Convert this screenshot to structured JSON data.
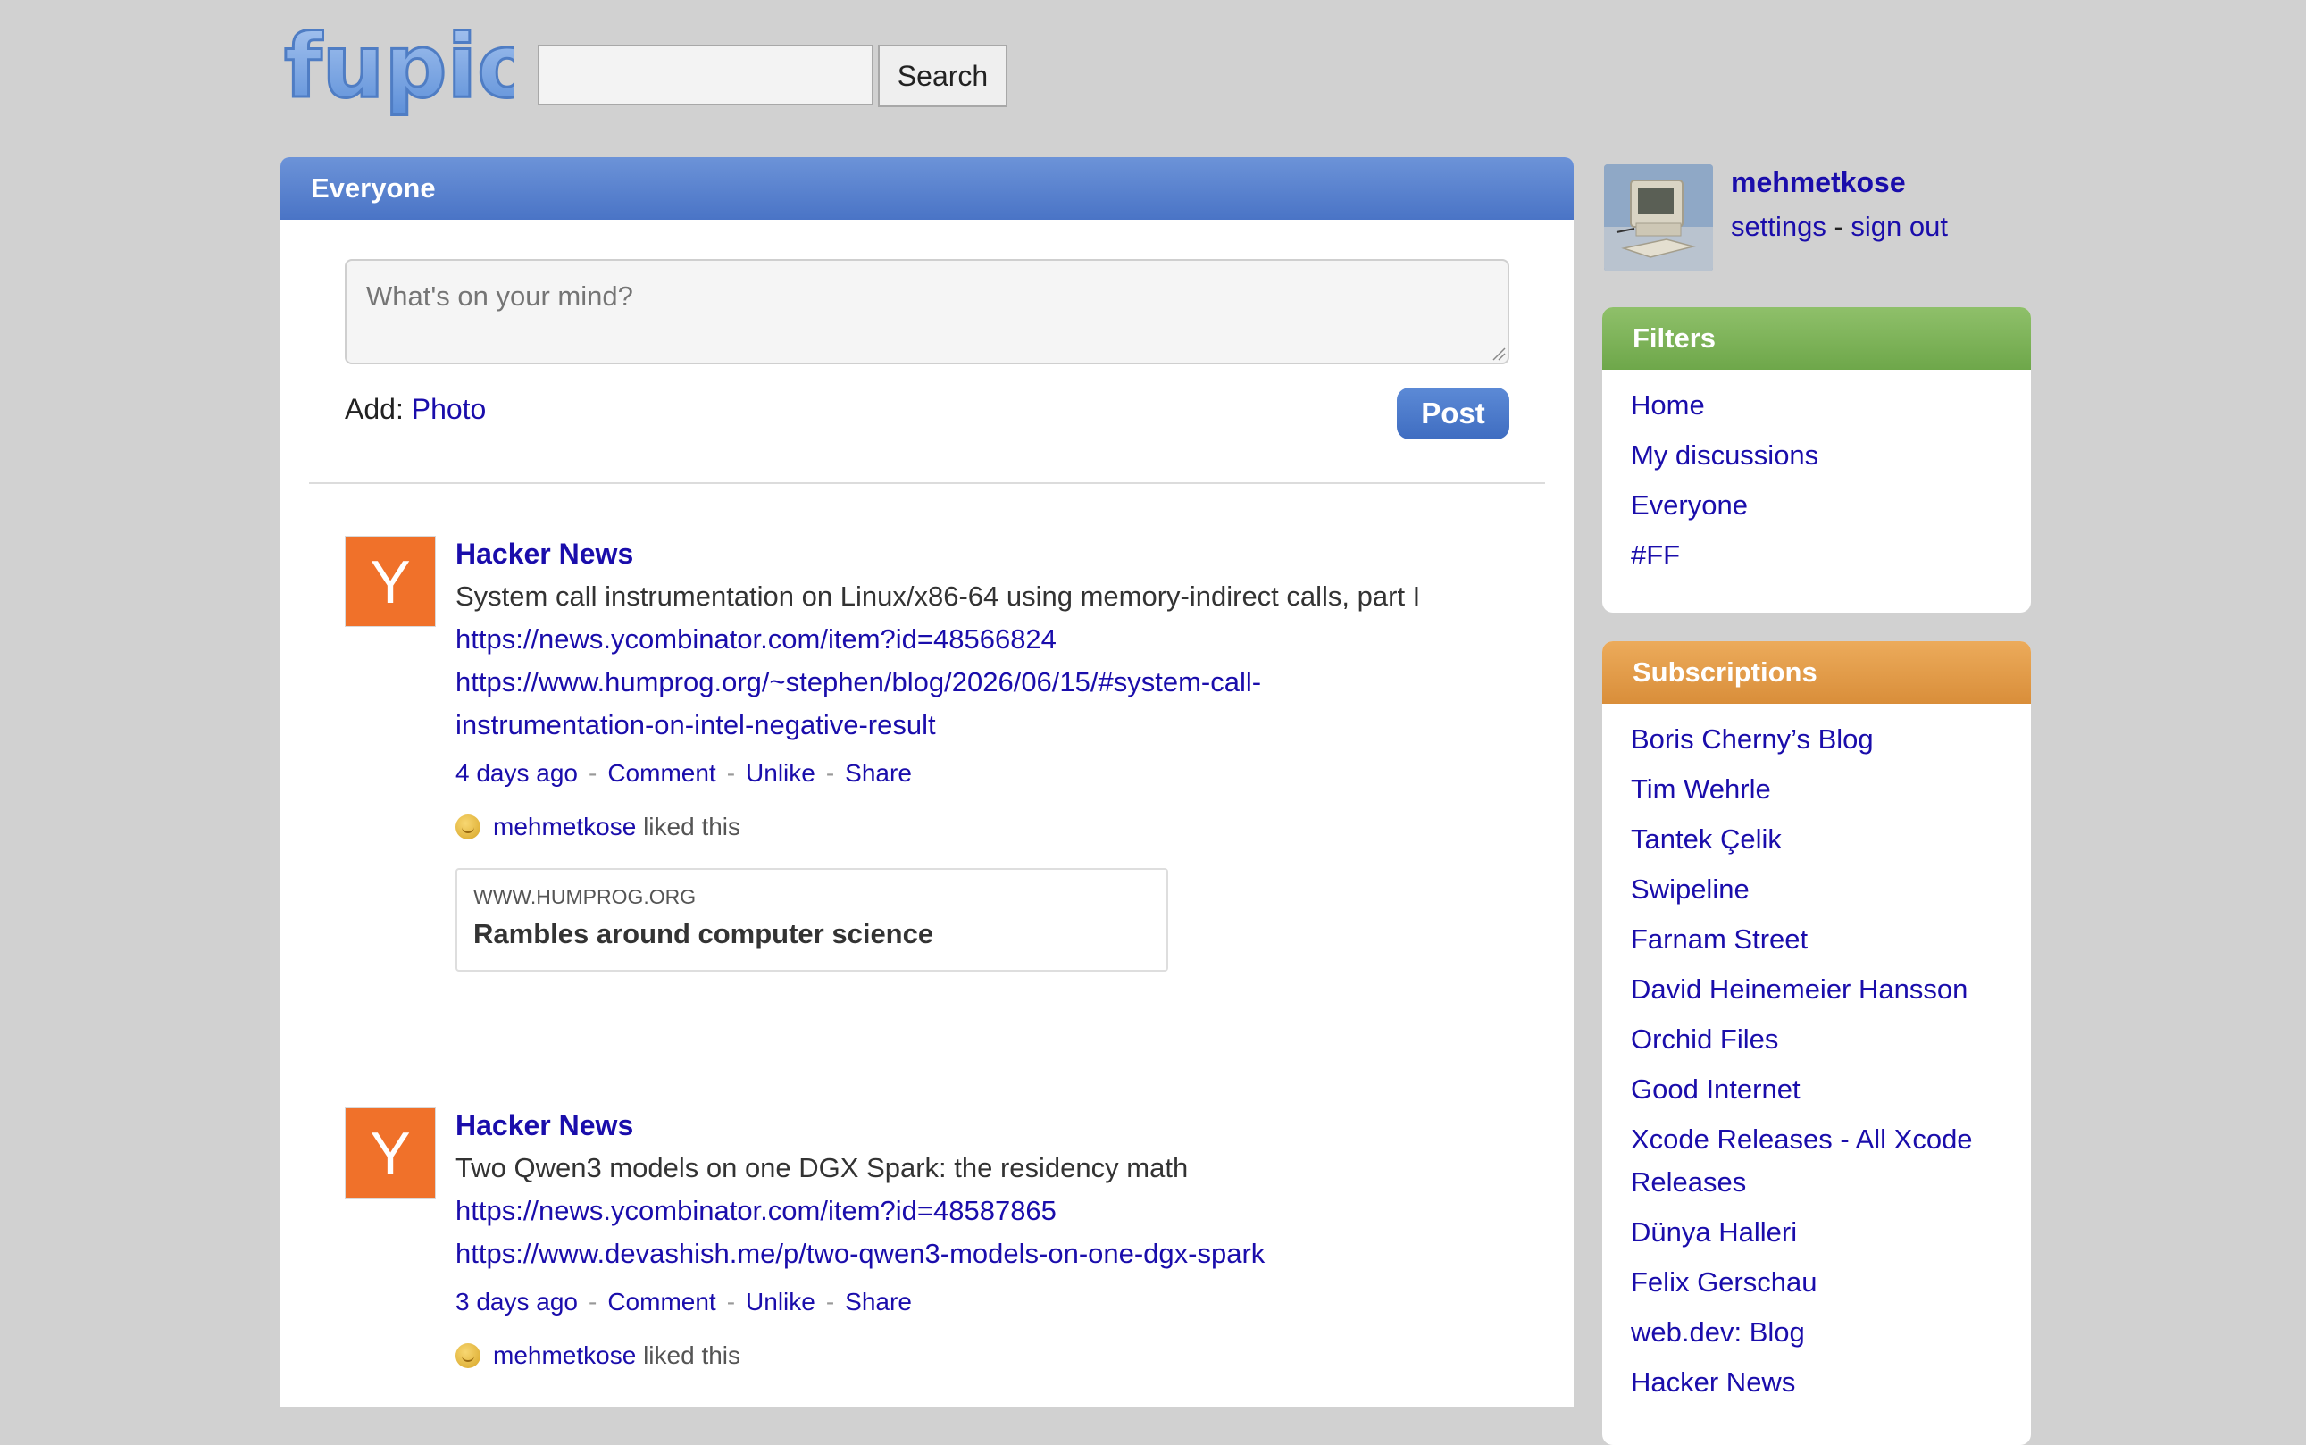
{
  "header": {
    "logo_text": "fupio",
    "search": {
      "value": "",
      "placeholder": ""
    },
    "search_button_label": "Search"
  },
  "feed": {
    "title": "Everyone",
    "composer": {
      "placeholder": "What's on your mind?",
      "value": ""
    },
    "add_label": "Add:",
    "add_photo_label": "Photo",
    "post_button_label": "Post",
    "posts": [
      {
        "avatar_letter": "Y",
        "source": "Hacker News",
        "text": "System call instrumentation on Linux/x86-64 using memory-indirect calls, part I",
        "links": [
          "https://news.ycombinator.com/item?id=48566824",
          "https://www.humprog.org/~stephen/blog/2026/06/15/#system-call-instrumentation-on-intel-negative-result"
        ],
        "meta": {
          "time": "4 days ago",
          "comment": "Comment",
          "unlike": "Unlike",
          "share": "Share",
          "separator": "-"
        },
        "likes": {
          "user": "mehmetkose",
          "suffix": "liked this"
        },
        "card": {
          "domain": "WWW.HUMPROG.ORG",
          "title": "Rambles around computer science"
        }
      },
      {
        "avatar_letter": "Y",
        "source": "Hacker News",
        "text": "Two Qwen3 models on one DGX Spark: the residency math",
        "links": [
          "https://news.ycombinator.com/item?id=48587865",
          "https://www.devashish.me/p/two-qwen3-models-on-one-dgx-spark"
        ],
        "meta": {
          "time": "3 days ago",
          "comment": "Comment",
          "unlike": "Unlike",
          "share": "Share",
          "separator": "-"
        },
        "likes": {
          "user": "mehmetkose",
          "suffix": "liked this"
        }
      }
    ]
  },
  "user": {
    "name": "mehmetkose",
    "settings_label": "settings",
    "separator": "-",
    "signout_label": "sign out"
  },
  "filters": {
    "title": "Filters",
    "items": [
      "Home",
      "My discussions",
      "Everyone",
      "#FF"
    ]
  },
  "subscriptions": {
    "title": "Subscriptions",
    "items": [
      "Boris Cherny’s Blog",
      "Tim Wehrle",
      "Tantek Çelik",
      "Swipeline",
      "Farnam Street",
      "David Heinemeier Hansson",
      "Orchid Files",
      "Good Internet",
      "Xcode Releases - All Xcode Releases",
      "Dünya Halleri",
      "Felix Gerschau",
      "web.dev: Blog",
      "Hacker News"
    ]
  },
  "colors": {
    "page_bg": "#d1d1d1",
    "link": "#1a0dab",
    "feed_header": "#5a84cf",
    "filters_header": "#7db35a",
    "subscriptions_header": "#e29c48",
    "hn_orange": "#f0712a",
    "post_button": "#4a78c9"
  }
}
